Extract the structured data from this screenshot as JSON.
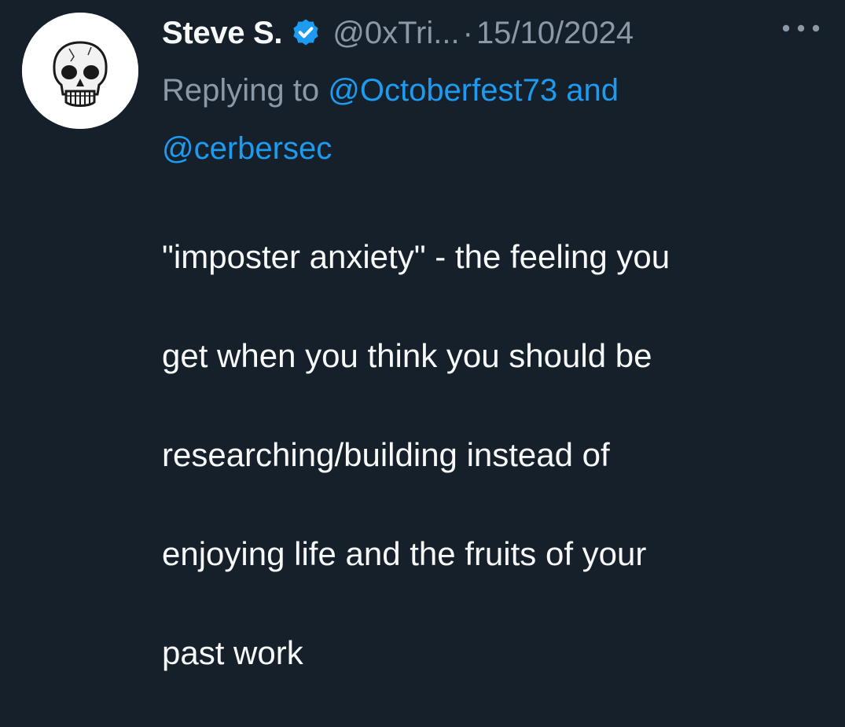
{
  "tweet": {
    "display_name": "Steve S.",
    "verified": true,
    "handle": "@0xTri...",
    "separator": "·",
    "date": "15/10/2024",
    "more_icon": "more-horizontal-icon",
    "reply_prefix": "Replying to ",
    "reply_mention_1": "@Octoberfest73",
    "reply_and": " and",
    "reply_mention_2": "@cerbersec",
    "text_lines": [
      "\"imposter anxiety\" - the feeling you",
      "get when you think you should be",
      "researching/building instead of",
      "enjoying life and the fruits of your",
      "past work"
    ]
  },
  "colors": {
    "background": "#15202b",
    "primary_text": "#f7f9f9",
    "secondary_text": "#8b98a5",
    "link": "#1d9bf0",
    "verified_badge": "#1d9bf0"
  }
}
